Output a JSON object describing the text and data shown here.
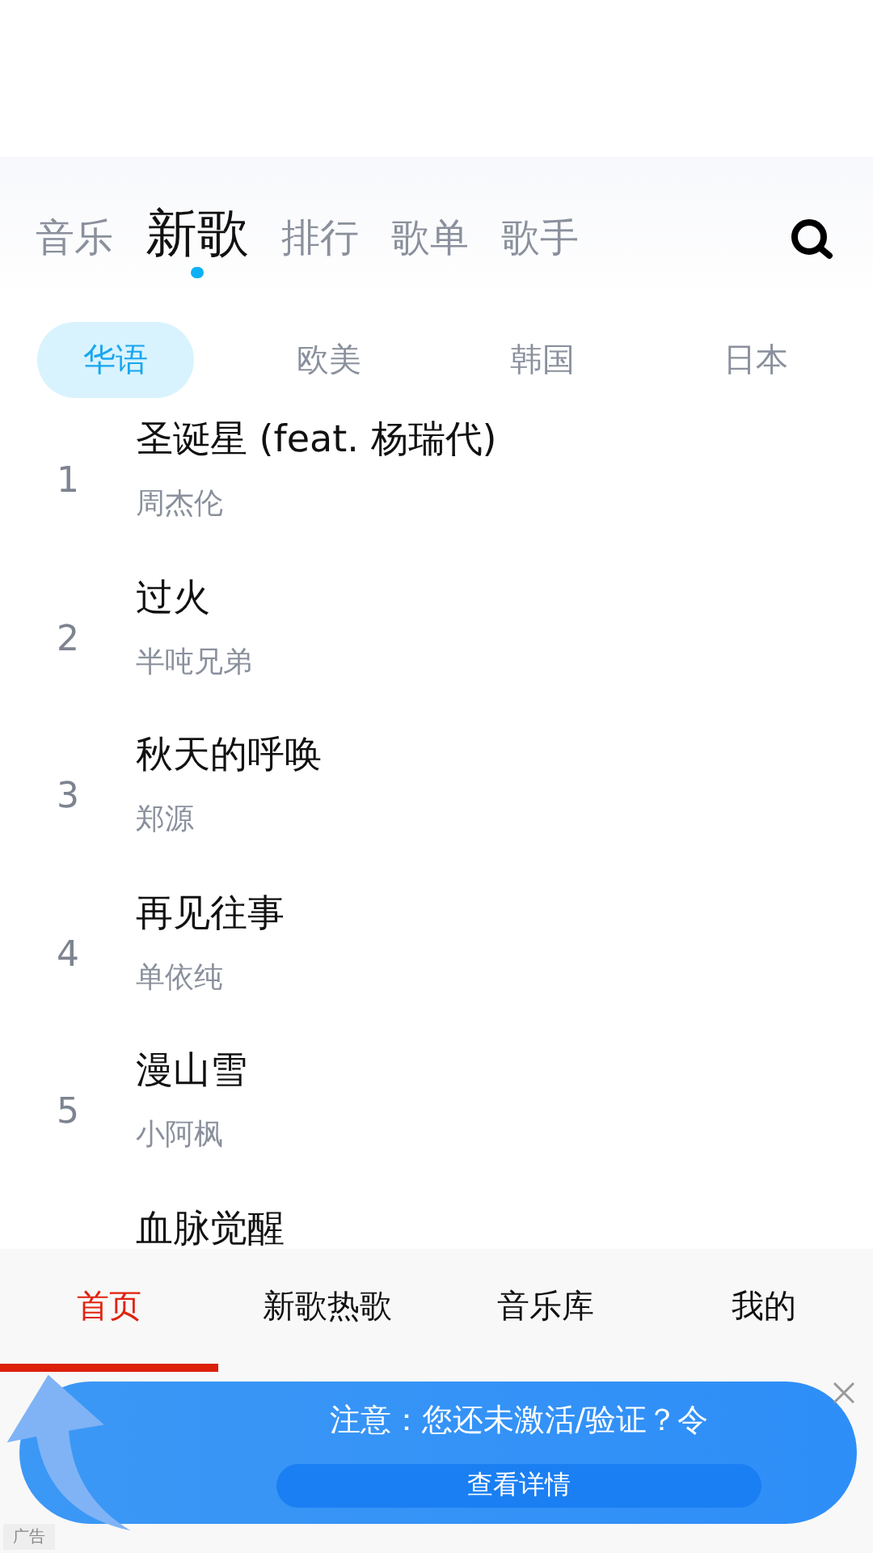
{
  "top_tabs": [
    {
      "label": "音乐",
      "selected": false
    },
    {
      "label": "新歌",
      "selected": true
    },
    {
      "label": "排行",
      "selected": false
    },
    {
      "label": "歌单",
      "selected": false
    },
    {
      "label": "歌手",
      "selected": false
    }
  ],
  "region_tabs": [
    {
      "label": "华语",
      "selected": true
    },
    {
      "label": "欧美",
      "selected": false
    },
    {
      "label": "韩国",
      "selected": false
    },
    {
      "label": "日本",
      "selected": false
    }
  ],
  "songs": [
    {
      "rank": "1",
      "title": "圣诞星 (feat. 杨瑞代)",
      "artist": "周杰伦"
    },
    {
      "rank": "2",
      "title": "过火",
      "artist": "半吨兄弟"
    },
    {
      "rank": "3",
      "title": "秋天的呼唤",
      "artist": "郑源"
    },
    {
      "rank": "4",
      "title": "再见往事",
      "artist": "单依纯"
    },
    {
      "rank": "5",
      "title": "漫山雪",
      "artist": "小阿枫"
    },
    {
      "title": "血脉觉醒"
    }
  ],
  "bottom_nav": [
    {
      "label": "首页",
      "selected": true
    },
    {
      "label": "新歌热歌",
      "selected": false
    },
    {
      "label": "音乐库",
      "selected": false
    },
    {
      "label": "我的",
      "selected": false
    }
  ],
  "ad": {
    "text": "注意：您还未激活/验证？令",
    "button": "查看详情",
    "tag": "广告"
  }
}
